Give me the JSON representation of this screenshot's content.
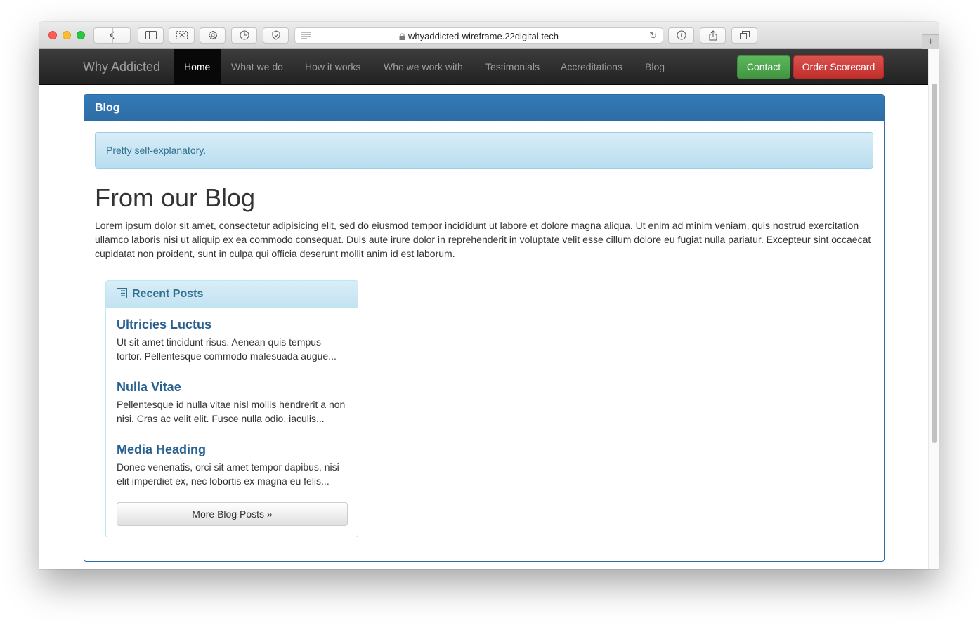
{
  "browser": {
    "url": "whyaddicted-wireframe.22digital.tech",
    "new_tab": "+"
  },
  "navbar": {
    "brand": "Why Addicted",
    "items": [
      {
        "label": "Home",
        "active": true
      },
      {
        "label": "What we do"
      },
      {
        "label": "How it works"
      },
      {
        "label": "Who we work with"
      },
      {
        "label": "Testimonials"
      },
      {
        "label": "Accreditations"
      },
      {
        "label": "Blog"
      }
    ],
    "contact_label": "Contact",
    "order_label": "Order Scorecard"
  },
  "panel": {
    "heading": "Blog",
    "alert": "Pretty self-explanatory.",
    "title": "From our Blog",
    "intro": "Lorem ipsum dolor sit amet, consectetur adipisicing elit, sed do eiusmod tempor incididunt ut labore et dolore magna aliqua. Ut enim ad minim veniam, quis nostrud exercitation ullamco laboris nisi ut aliquip ex ea commodo consequat. Duis aute irure dolor in reprehenderit in voluptate velit esse cillum dolore eu fugiat nulla pariatur. Excepteur sint occaecat cupidatat non proident, sunt in culpa qui officia deserunt mollit anim id est laborum."
  },
  "recent_posts": {
    "heading": "Recent Posts",
    "posts": [
      {
        "title": "Ultricies Luctus",
        "excerpt": "Ut sit amet tincidunt risus. Aenean quis tempus tortor. Pellentesque commodo malesuada augue..."
      },
      {
        "title": "Nulla Vitae",
        "excerpt": "Pellentesque id nulla vitae nisl mollis hendrerit a non nisi. Cras ac velit elit. Fusce nulla odio, iaculis..."
      },
      {
        "title": "Media Heading",
        "excerpt": "Donec venenatis, orci sit amet tempor dapibus, nisi elit imperdiet ex, nec lobortis ex magna eu felis..."
      }
    ],
    "more_label": "More Blog Posts »"
  },
  "colors": {
    "navbar_bg": "#222222",
    "primary": "#337ab7",
    "success": "#5cb85c",
    "danger": "#d9534f",
    "info_bg": "#d9edf7"
  }
}
